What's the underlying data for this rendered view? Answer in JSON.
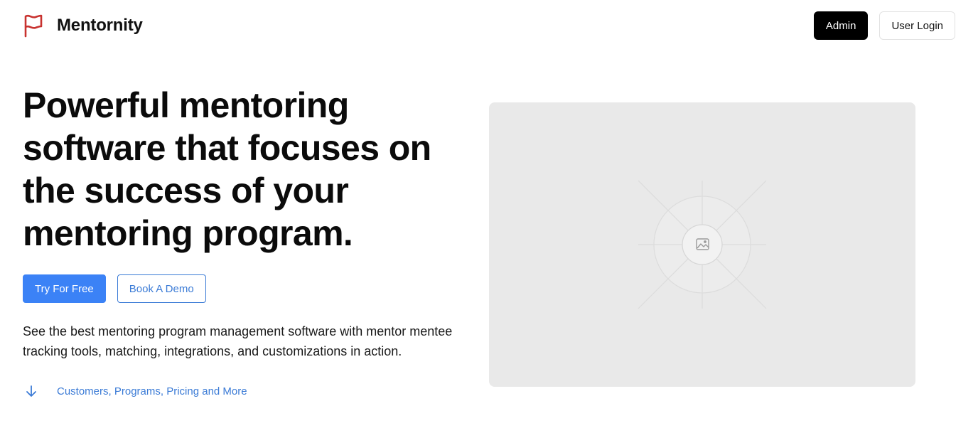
{
  "header": {
    "brand_name": "Mentornity",
    "admin_label": "Admin",
    "login_label": "User Login"
  },
  "hero": {
    "title": "Powerful mentoring software that focuses on the success of your mentoring program.",
    "try_label": "Try For Free",
    "demo_label": "Book A Demo",
    "description": "See the best mentoring program management software with mentor mentee tracking tools, matching, integrations, and customizations in action.",
    "more_label": "Customers, Programs, Pricing and More"
  },
  "colors": {
    "accent": "#3b82f6",
    "link": "#3b7bd6",
    "logo_red": "#c8322f",
    "placeholder_bg": "#e9e9e9"
  },
  "icons": {
    "logo": "flag-icon",
    "more": "arrow-down-icon",
    "media": "image-placeholder-icon"
  }
}
